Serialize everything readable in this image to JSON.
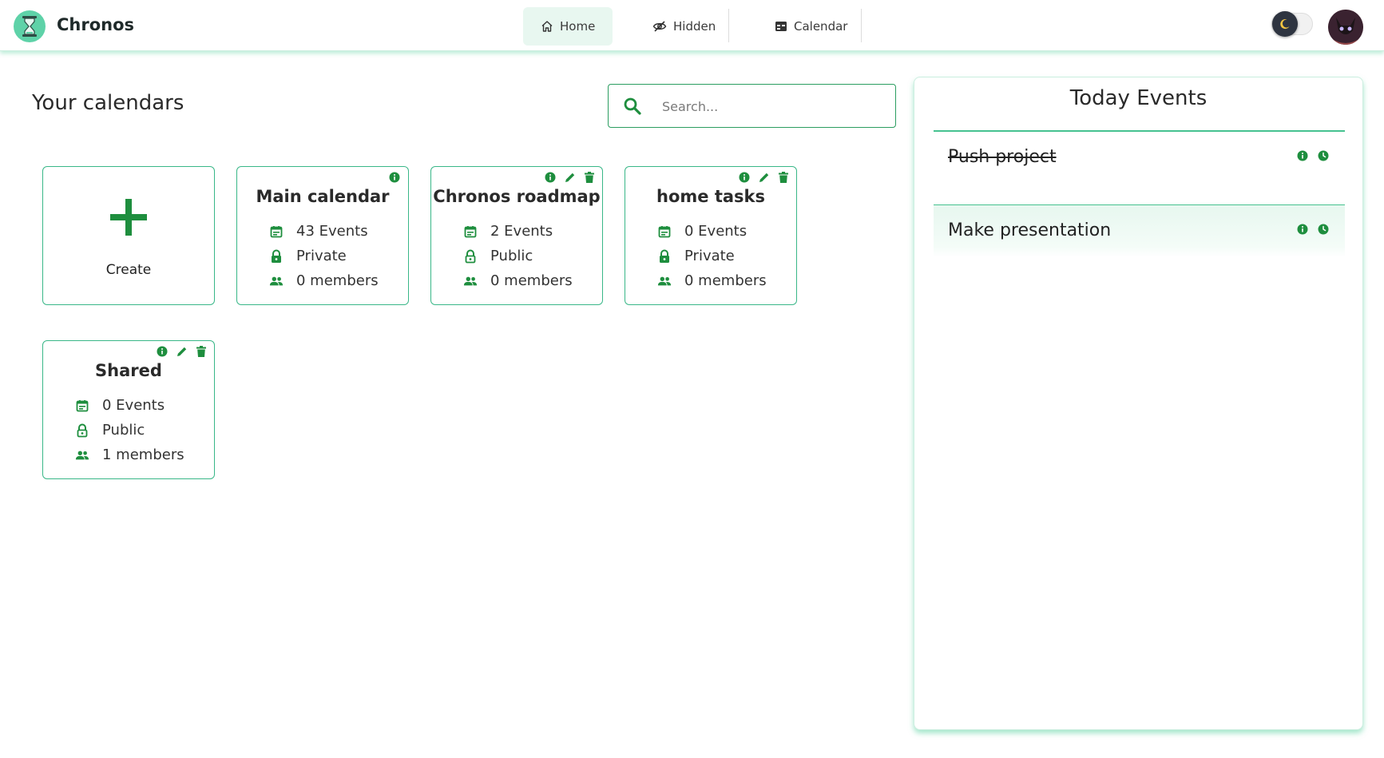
{
  "app": {
    "title": "Chronos",
    "accent": "#1e8e3e",
    "border": "#39b788",
    "logo": "hourglass-icon"
  },
  "nav": [
    {
      "label": "Home",
      "icon": "home-icon",
      "active": true
    },
    {
      "label": "Hidden",
      "icon": "eye-off-icon",
      "active": false
    },
    {
      "label": "Calendar",
      "icon": "calendar-table-icon",
      "active": false
    }
  ],
  "theme_toggle": {
    "icon": "moon-icon",
    "state": "off"
  },
  "main": {
    "title": "Your calendars",
    "search": {
      "placeholder": "Search...",
      "value": ""
    },
    "create": {
      "label": "Create"
    },
    "calendars": [
      {
        "name": "Main calendar",
        "events": "43 Events",
        "visibility": "Private",
        "members": "0 members",
        "actions": [
          "info"
        ]
      },
      {
        "name": "Chronos roadmap",
        "events": "2 Events",
        "visibility": "Public",
        "members": "0 members",
        "actions": [
          "info",
          "edit",
          "delete"
        ]
      },
      {
        "name": "home tasks",
        "events": "0 Events",
        "visibility": "Private",
        "members": "0 members",
        "actions": [
          "info",
          "edit",
          "delete"
        ]
      },
      {
        "name": "Shared",
        "events": "0 Events",
        "visibility": "Public",
        "members": "1 members",
        "actions": [
          "info",
          "edit",
          "delete"
        ]
      }
    ]
  },
  "today": {
    "title": "Today Events",
    "events": [
      {
        "title": "Push project",
        "completed": true
      },
      {
        "title": "Make presentation",
        "completed": false
      }
    ]
  }
}
